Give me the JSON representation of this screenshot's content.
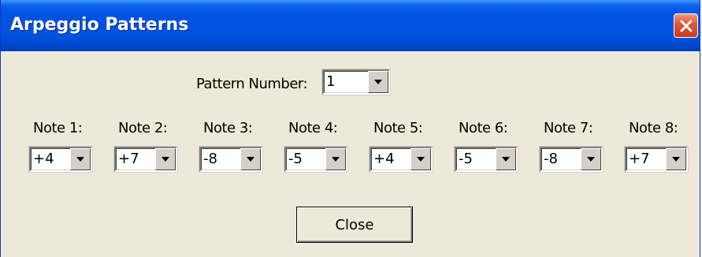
{
  "window": {
    "title": "Arpeggio Patterns"
  },
  "pattern": {
    "label": "Pattern Number:",
    "value": "1"
  },
  "notes": [
    {
      "label": "Note 1:",
      "value": "+4"
    },
    {
      "label": "Note 2:",
      "value": "+7"
    },
    {
      "label": "Note 3:",
      "value": "-8"
    },
    {
      "label": "Note 4:",
      "value": "-5"
    },
    {
      "label": "Note 5:",
      "value": "+4"
    },
    {
      "label": "Note 6:",
      "value": "-5"
    },
    {
      "label": "Note 7:",
      "value": "-8"
    },
    {
      "label": "Note 8:",
      "value": "+7"
    }
  ],
  "buttons": {
    "close_label": "Close"
  },
  "icons": {
    "close": "close-icon",
    "dropdown": "chevron-down-icon"
  },
  "colors": {
    "titlebar": "#0053e1",
    "dialog_bg": "#ece9d8",
    "close_button": "#c93a1c"
  }
}
